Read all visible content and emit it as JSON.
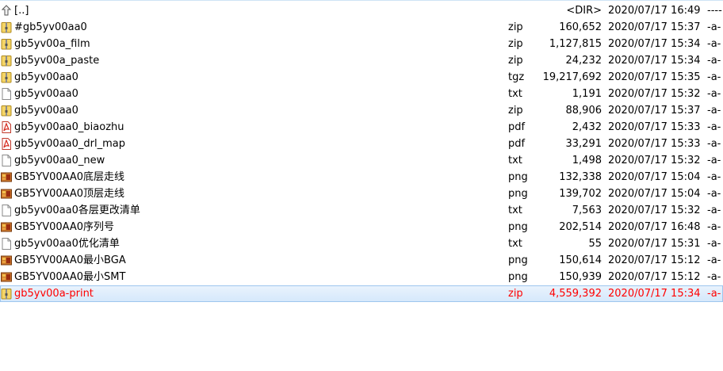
{
  "files": [
    {
      "name": "[..]",
      "ext": "",
      "size": "<DIR>",
      "date": "2020/07/17 16:49",
      "attr": "----",
      "icon": "up-dir-icon"
    },
    {
      "name": "#gb5yv00aa0",
      "ext": "zip",
      "size": "160,652",
      "date": "2020/07/17 15:37",
      "attr": "-a-",
      "icon": "archive-icon"
    },
    {
      "name": "gb5yv00a_film",
      "ext": "zip",
      "size": "1,127,815",
      "date": "2020/07/17 15:34",
      "attr": "-a-",
      "icon": "archive-icon"
    },
    {
      "name": "gb5yv00a_paste",
      "ext": "zip",
      "size": "24,232",
      "date": "2020/07/17 15:34",
      "attr": "-a-",
      "icon": "archive-icon"
    },
    {
      "name": "gb5yv00aa0",
      "ext": "tgz",
      "size": "19,217,692",
      "date": "2020/07/17 15:35",
      "attr": "-a-",
      "icon": "archive-icon"
    },
    {
      "name": "gb5yv00aa0",
      "ext": "txt",
      "size": "1,191",
      "date": "2020/07/17 15:32",
      "attr": "-a-",
      "icon": "text-file-icon"
    },
    {
      "name": "gb5yv00aa0",
      "ext": "zip",
      "size": "88,906",
      "date": "2020/07/17 15:37",
      "attr": "-a-",
      "icon": "archive-icon"
    },
    {
      "name": "gb5yv00aa0_biaozhu",
      "ext": "pdf",
      "size": "2,432",
      "date": "2020/07/17 15:33",
      "attr": "-a-",
      "icon": "pdf-icon"
    },
    {
      "name": "gb5yv00aa0_drl_map",
      "ext": "pdf",
      "size": "33,291",
      "date": "2020/07/17 15:33",
      "attr": "-a-",
      "icon": "pdf-icon"
    },
    {
      "name": "gb5yv00aa0_new",
      "ext": "txt",
      "size": "1,498",
      "date": "2020/07/17 15:32",
      "attr": "-a-",
      "icon": "text-file-icon"
    },
    {
      "name": "GB5YV00AA0底层走线",
      "ext": "png",
      "size": "132,338",
      "date": "2020/07/17 15:04",
      "attr": "-a-",
      "icon": "image-icon"
    },
    {
      "name": "GB5YV00AA0顶层走线",
      "ext": "png",
      "size": "139,702",
      "date": "2020/07/17 15:04",
      "attr": "-a-",
      "icon": "image-icon"
    },
    {
      "name": "gb5yv00aa0各层更改清单",
      "ext": "txt",
      "size": "7,563",
      "date": "2020/07/17 15:32",
      "attr": "-a-",
      "icon": "text-file-icon"
    },
    {
      "name": "GB5YV00AA0序列号",
      "ext": "png",
      "size": "202,514",
      "date": "2020/07/17 16:48",
      "attr": "-a-",
      "icon": "image-icon"
    },
    {
      "name": "gb5yv00aa0优化清单",
      "ext": "txt",
      "size": "55",
      "date": "2020/07/17 15:31",
      "attr": "-a-",
      "icon": "text-file-icon"
    },
    {
      "name": "GB5YV00AA0最小BGA",
      "ext": "png",
      "size": "150,614",
      "date": "2020/07/17 15:12",
      "attr": "-a-",
      "icon": "image-icon"
    },
    {
      "name": "GB5YV00AA0最小SMT",
      "ext": "png",
      "size": "150,939",
      "date": "2020/07/17 15:12",
      "attr": "-a-",
      "icon": "image-icon"
    },
    {
      "name": "gb5yv00a-print",
      "ext": "zip",
      "size": "4,559,392",
      "date": "2020/07/17 15:34",
      "attr": "-a-",
      "icon": "archive-icon"
    }
  ],
  "selected_index": 17,
  "colors": {
    "selected_text": "#ff0000",
    "selection_bg": "#d5e8fb"
  }
}
